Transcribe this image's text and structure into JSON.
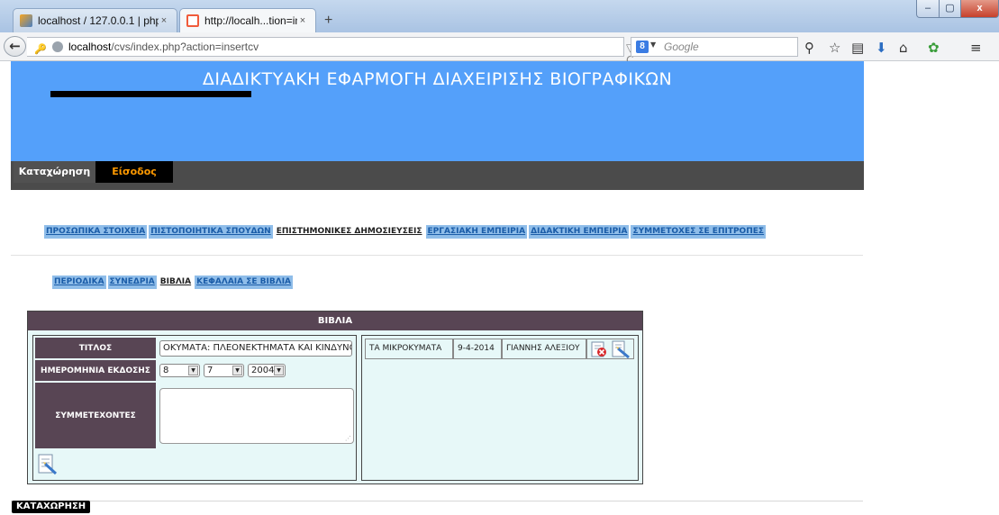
{
  "browser": {
    "tabs": [
      {
        "title": "localhost / 127.0.0.1 | php...",
        "close": "×"
      },
      {
        "title": "http://localh...tion=insertcv",
        "close": "×"
      }
    ],
    "new_tab": "+",
    "window_controls": {
      "minimize": "–",
      "maximize": "▢",
      "close": "x"
    },
    "back": "←",
    "url_host": "localhost",
    "url_path": "/cvs/index.php?action=insertcv",
    "url_controls": "▽ C",
    "search_engine_letter": "8",
    "search_placeholder": "Google",
    "toolbar_icons": [
      "search-icon",
      "bookmark-star-icon",
      "reading-list-icon",
      "download-icon",
      "home-icon",
      "addon-icon",
      "menu-icon"
    ]
  },
  "site": {
    "title": "ΔΙΑΔΙΚΤΥΑΚΗ ΕΦΑΡΜΟΓΗ ΔΙΑΧΕΙΡΙΣΗΣ ΒΙΟΓΡΑΦΙΚΩΝ",
    "banner_color": "#54a0fa",
    "menu": {
      "register": "Καταχώρηση",
      "login": "Είσοδος"
    }
  },
  "sections": [
    {
      "label": "ΠΡΟΣΩΠΙΚΑ ΣΤΟΙΧΕΙΑ",
      "active": false
    },
    {
      "label": "ΠΙΣΤΟΠΟΙΗΤΙΚΑ ΣΠΟΥΔΩΝ",
      "active": false
    },
    {
      "label": "ΕΠΙΣΤΗΜΟΝΙΚΕΣ ΔΗΜΟΣΙΕΥΣΕΙΣ",
      "active": true
    },
    {
      "label": "ΕΡΓΑΣΙΑΚΗ ΕΜΠΕΙΡΙΑ",
      "active": false
    },
    {
      "label": "ΔΙΔΑΚΤΙΚΗ ΕΜΠΕΙΡΙΑ",
      "active": false
    },
    {
      "label": "ΣΥΜΜΕΤΟΧΕΣ ΣΕ ΕΠΙΤΡΟΠΕΣ",
      "active": false
    }
  ],
  "subsections": [
    {
      "label": "ΠΕΡΙΟΔΙΚΑ",
      "active": false
    },
    {
      "label": "ΣΥΝΕΔΡΙΑ",
      "active": false
    },
    {
      "label": "ΒΙΒΛΙΑ",
      "active": true
    },
    {
      "label": "ΚΕΦΑΛΑΙΑ ΣΕ ΒΙΒΛΙΑ",
      "active": false
    }
  ],
  "books": {
    "header": "ΒΙΒΛΙΑ",
    "form": {
      "title_label": "ΤΙΤΛΟΣ",
      "title_value": "ΟΚΥΜΑΤΑ: ΠΛΕΟΝΕΚΤΗΜΑΤΑ ΚΑΙ ΚΙΝΔΥΝΟΙ",
      "date_label": "ΗΜΕΡΟΜΗΝΙΑ ΕΚΔΟΣΗΣ",
      "day": "8",
      "month": "7",
      "year": "2004",
      "participants_label": "ΣΥΜΜΕΤΕΧΟΝΤΕΣ",
      "participants_value": ""
    },
    "rows": [
      {
        "title": "ΤΑ ΜΙΚΡΟΚΥΜΑΤΑ",
        "date": "9-4-2014",
        "author": "ΓΙΑΝΝΗΣ ΑΛΕΞΙΟΥ"
      }
    ]
  },
  "submit_label": "ΚΑΤΑΧΩΡΗΣΗ"
}
